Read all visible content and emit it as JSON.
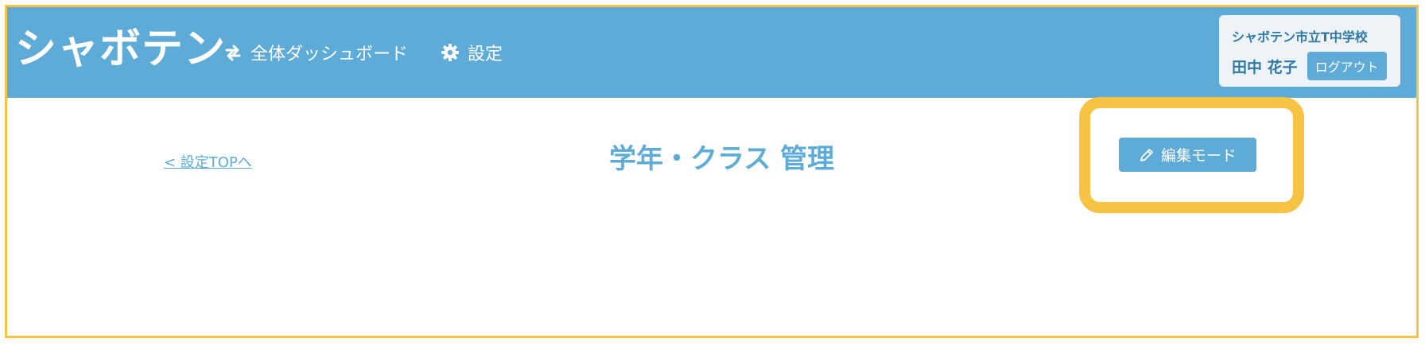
{
  "app": {
    "logo": "シャボテン"
  },
  "nav": {
    "dashboard": {
      "label": "全体ダッシュボード",
      "icon": "sync-icon"
    },
    "settings": {
      "label": "設定",
      "icon": "gear-icon"
    }
  },
  "user": {
    "school": "シャボテン市立T中学校",
    "name": "田中 花子",
    "logout_label": "ログアウト"
  },
  "page": {
    "back_link": "< 設定TOPへ",
    "title": "学年・クラス 管理",
    "edit_button": {
      "label": "編集モード",
      "icon": "pencil-icon"
    }
  },
  "colors": {
    "header": "#5dabd6",
    "highlight": "#f6c344",
    "accent_text": "#2e7aa3"
  }
}
